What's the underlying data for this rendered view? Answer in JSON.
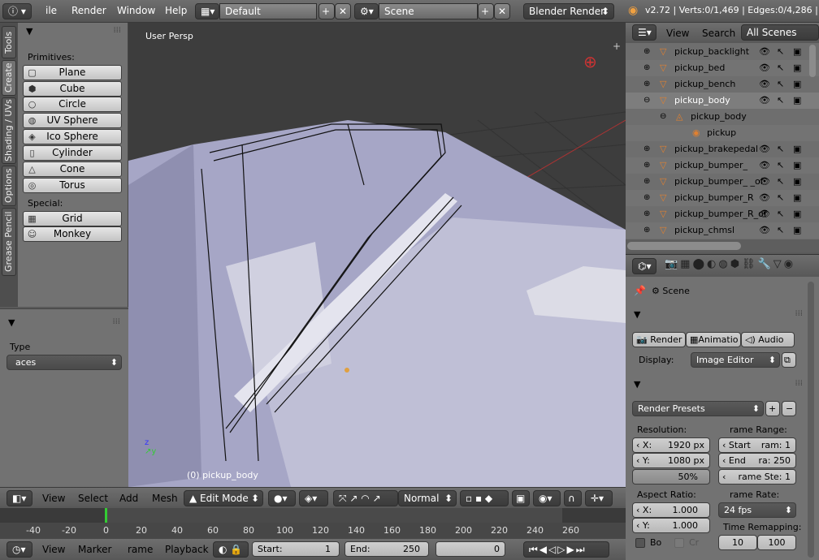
{
  "topbar": {
    "menu": [
      "ile",
      "Render",
      "Window",
      "Help"
    ],
    "screen_layout": "Default",
    "scene": "Scene",
    "engine": "Blender Render",
    "stats": "v2.72 | Verts:0/1,469 | Edges:0/4,286 |"
  },
  "tool_tabs": [
    "Tools",
    "Create",
    "Shading / UVs",
    "Options",
    "Grease Pencil"
  ],
  "shelf": {
    "primitives_label": "Primitives:",
    "primitives": [
      "Plane",
      "Cube",
      "Circle",
      "UV Sphere",
      "Ico Sphere",
      "Cylinder",
      "Cone",
      "Torus"
    ],
    "special_label": "Special:",
    "special": [
      "Grid",
      "Monkey"
    ]
  },
  "last_op": {
    "type_label": "Type",
    "type_value": "aces"
  },
  "viewport": {
    "view_name": "User Persp",
    "object_label": "(0) pickup_body"
  },
  "vp_header": {
    "menus": [
      "View",
      "Select",
      "Add",
      "Mesh"
    ],
    "mode": "Edit Mode",
    "orientation": "Normal"
  },
  "timeline": {
    "ticks": [
      "-40",
      "-20",
      "0",
      "20",
      "40",
      "60",
      "80",
      "100",
      "120",
      "140",
      "160",
      "180",
      "200",
      "220",
      "240",
      "260"
    ],
    "menus": [
      "View",
      "Marker",
      "rame",
      "Playback"
    ],
    "start_label": "Start:",
    "start": "1",
    "end_label": "End:",
    "end": "250",
    "current": "0"
  },
  "outliner": {
    "menus": [
      "View",
      "Search"
    ],
    "filter": "All Scenes",
    "rows": [
      "pickup_backlight",
      "pickup_bed",
      "pickup_bench",
      "pickup_body",
      "pickup_body",
      "pickup",
      "pickup_brakepedal",
      "pickup_bumper_",
      "pickup_bumper_ _of",
      "pickup_bumper_R",
      "pickup_bumper_R_of",
      "pickup_chmsl"
    ]
  },
  "properties": {
    "scene": "Scene",
    "buttons": [
      "Render",
      "Animatio",
      "Audio"
    ],
    "display_label": "Display:",
    "display_value": "Image Editor",
    "presets": "Render Presets",
    "resolution_label": "Resolution:",
    "res_x_label": "X:",
    "res_x": "1920 px",
    "res_y_label": "Y:",
    "res_y": "1080 px",
    "res_pct": "50%",
    "frame_range_label": "rame Range:",
    "start_label": "Start",
    "start_value": "ram: 1",
    "end_label": "End",
    "end_value": "ra: 250",
    "step_label": "rame Ste: 1",
    "aspect_label": "Aspect Ratio:",
    "asp_x_label": "X:",
    "asp_x": "1.000",
    "asp_y_label": "Y:",
    "asp_y": "1.000",
    "frame_rate_label": "rame Rate:",
    "fps": "24 fps",
    "remap_label": "Time Remapping:",
    "remap_old": "10",
    "remap_new": "100",
    "border_label": "Bo",
    "crop_label": "Cr"
  }
}
